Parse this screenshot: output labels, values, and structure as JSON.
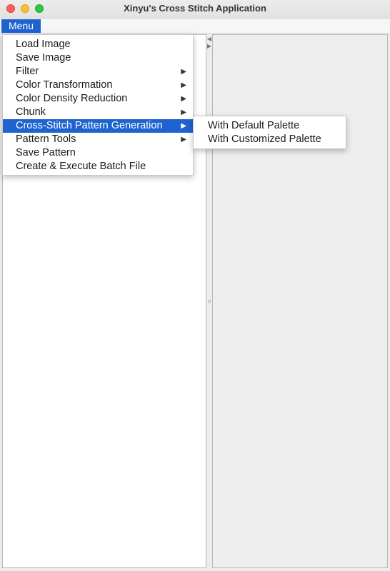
{
  "window": {
    "title": "Xinyu's Cross Stitch Application"
  },
  "menubar": {
    "menu_label": "Menu"
  },
  "menu": {
    "items": [
      {
        "label": "Load Image",
        "submenu": false
      },
      {
        "label": "Save Image",
        "submenu": false
      },
      {
        "label": "Filter",
        "submenu": true
      },
      {
        "label": "Color Transformation",
        "submenu": true
      },
      {
        "label": "Color Density Reduction",
        "submenu": true
      },
      {
        "label": "Chunk",
        "submenu": true
      },
      {
        "label": "Cross-Stitch Pattern Generation",
        "submenu": true,
        "highlighted": true
      },
      {
        "label": "Pattern Tools",
        "submenu": true
      },
      {
        "label": "Save Pattern",
        "submenu": false
      },
      {
        "label": "Create & Execute Batch File",
        "submenu": false
      }
    ],
    "submenu_arrow": "▶"
  },
  "submenu": {
    "items": [
      {
        "label": "With Default Palette"
      },
      {
        "label": "With Customized Palette"
      }
    ]
  },
  "divider": {
    "arrow_left": "◀",
    "arrow_right": "▶"
  },
  "colors": {
    "accent": "#1f63d1",
    "menu_bg": "#ffffff",
    "pane_bg": "#eeeeee"
  }
}
